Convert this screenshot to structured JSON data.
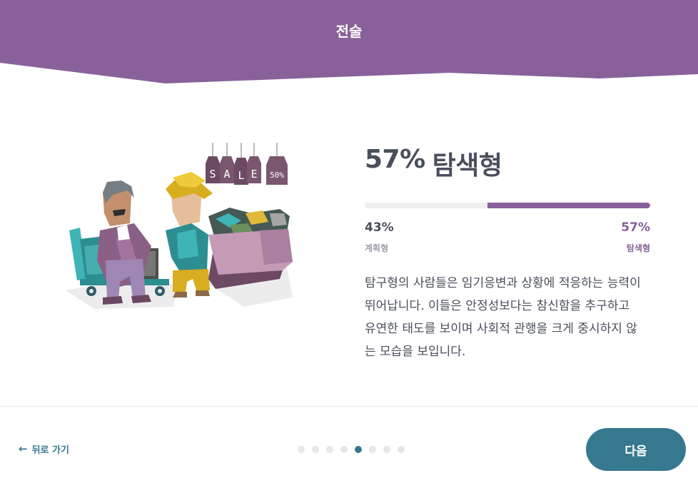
{
  "header": {
    "title": "전술",
    "color": "#88619a"
  },
  "illustration": {
    "sign_letters": [
      "S",
      "A",
      "L",
      "E"
    ],
    "sign_discount": "50%"
  },
  "result": {
    "headline_percent": "57%",
    "headline_type": "탐색형",
    "progress": {
      "left_value": 43,
      "right_value": 57
    },
    "left_percent": "43%",
    "right_percent": "57%",
    "left_label": "계획형",
    "right_label": "탐색형",
    "description": "탐구형의 사람들은 임기응변과 상황에 적응하는 능력이 뛰어납니다. 이들은 안정성보다는 참신함을 추구하고 유연한 태도를 보이며 사회적 관행을 크게 중시하지 않는 모습을 보입니다."
  },
  "footer": {
    "back_label": "뒤로 가기",
    "next_label": "다음",
    "pagination": {
      "total": 8,
      "current": 5
    }
  },
  "colors": {
    "accent": "#36798f",
    "purple": "#88619a",
    "text": "#4a4f5c",
    "muted": "#9ea2ab"
  }
}
